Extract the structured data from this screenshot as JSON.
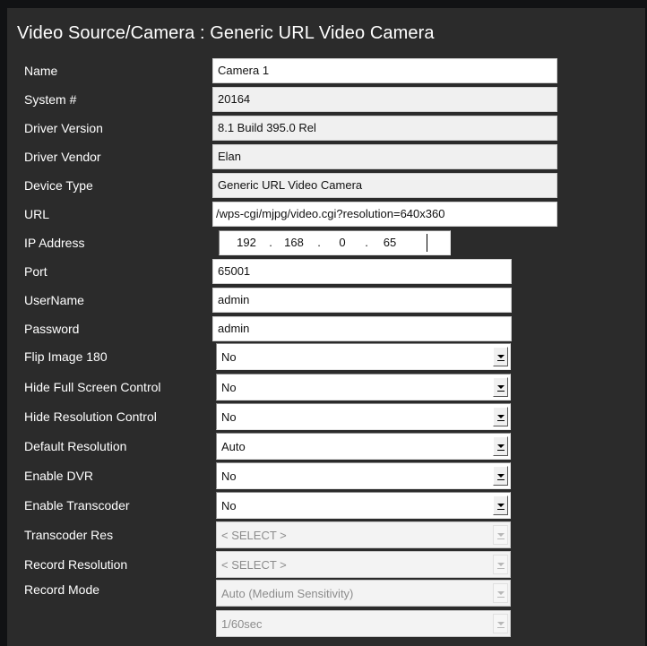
{
  "title": "Video Source/Camera : Generic URL Video Camera",
  "labels": {
    "name": "Name",
    "system": "System #",
    "driver_version": "Driver Version",
    "driver_vendor": "Driver Vendor",
    "device_type": "Device Type",
    "url": "URL",
    "ip": "IP Address",
    "port": "Port",
    "username": "UserName",
    "password": "Password",
    "flip": "Flip Image 180",
    "hide_fullscreen": "Hide Full Screen Control",
    "hide_resolution": "Hide Resolution Control",
    "default_res": "Default Resolution",
    "enable_dvr": "Enable DVR",
    "enable_transcoder": "Enable Transcoder",
    "transcoder_res": "Transcoder Res",
    "record_res": "Record Resolution",
    "record_mode": "Record Mode"
  },
  "values": {
    "name": "Camera 1",
    "system": "20164",
    "driver_version": "8.1 Build 395.0 Rel",
    "driver_vendor": "Elan",
    "device_type": "Generic URL Video Camera",
    "url": "/wps-cgi/mjpg/video.cgi?resolution=640x360",
    "ip": [
      "192",
      "168",
      "0",
      "65"
    ],
    "ip_sep": ".",
    "port": "65001",
    "username": "admin",
    "password": "admin"
  },
  "selects": {
    "flip": "No",
    "hide_fullscreen": "No",
    "hide_resolution": "No",
    "default_res": "Auto",
    "enable_dvr": "No",
    "enable_transcoder": "No",
    "transcoder_res": "< SELECT >",
    "record_res": "< SELECT >",
    "record_mode": "Auto (Medium Sensitivity)",
    "shutter": "1/60sec"
  },
  "icons": {
    "dropdown": "chevron-down-icon"
  },
  "colors": {
    "panel_bg": "#2b2b2b",
    "label_text": "#ffffff",
    "readonly_bg": "#f0f0f0"
  }
}
